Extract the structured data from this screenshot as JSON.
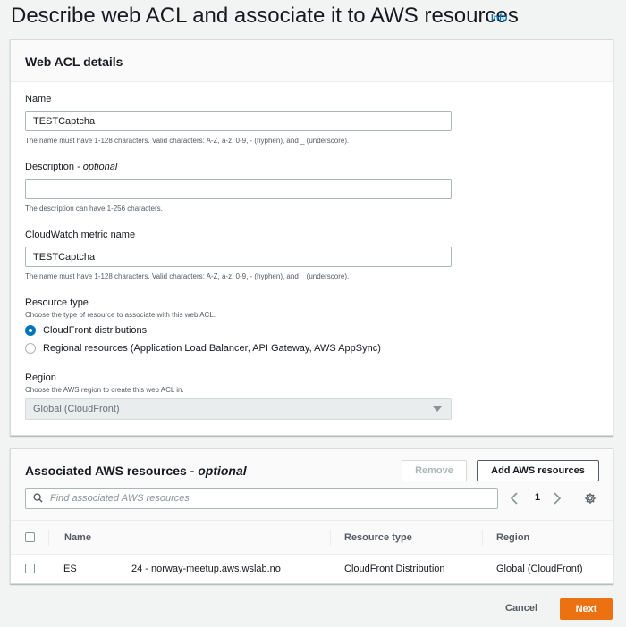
{
  "page": {
    "title": "Describe web ACL and associate it to AWS resources",
    "info_link": "Info"
  },
  "details": {
    "title": "Web ACL details",
    "name": {
      "label": "Name",
      "value": "TESTCaptcha",
      "hint": "The name must have 1-128 characters. Valid characters: A-Z, a-z, 0-9, - (hyphen), and _ (underscore)."
    },
    "description": {
      "label": "Description - ",
      "label_optional": "optional",
      "value": "",
      "hint": "The description can have 1-256 characters."
    },
    "metric": {
      "label": "CloudWatch metric name",
      "value": "TESTCaptcha",
      "hint": "The name must have 1-128 characters. Valid characters: A-Z, a-z, 0-9, - (hyphen), and _ (underscore)."
    },
    "resource_type": {
      "label": "Resource type",
      "hint": "Choose the type of resource to associate with this web ACL.",
      "options": [
        {
          "label": "CloudFront distributions",
          "selected": true
        },
        {
          "label": "Regional resources (Application Load Balancer, API Gateway, AWS AppSync)",
          "selected": false
        }
      ]
    },
    "region": {
      "label": "Region",
      "hint": "Choose the AWS region to create this web ACL in.",
      "value": "Global (CloudFront)"
    }
  },
  "resources": {
    "title": "Associated AWS resources - ",
    "title_optional": "optional",
    "remove_label": "Remove",
    "add_label": "Add AWS resources",
    "search_placeholder": "Find associated AWS resources",
    "page": "1",
    "columns": [
      "Name",
      "Resource type",
      "Region"
    ],
    "rows": [
      {
        "name_start": "ES",
        "name_end": "24 - norway-meetup.aws.wslab.no",
        "type": "CloudFront Distribution",
        "region": "Global (CloudFront)"
      }
    ]
  },
  "footer": {
    "cancel_label": "Cancel",
    "next_label": "Next"
  },
  "colors": {
    "accent": "#0073bb",
    "primary_button": "#ec7211"
  }
}
